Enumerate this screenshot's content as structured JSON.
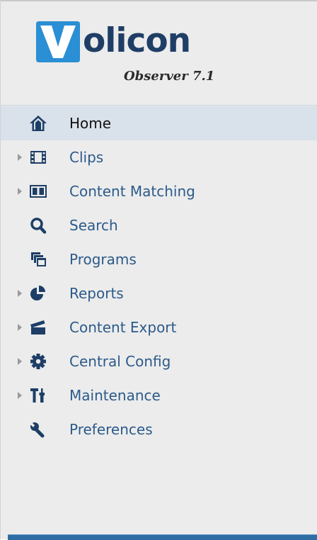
{
  "brand": {
    "logo_text": "olicon",
    "logo_initial": "V",
    "subtitle": "Observer 7.1",
    "logo_color": "#1f3e66",
    "accent_color": "#2a8fd4"
  },
  "nav": {
    "items": [
      {
        "label": "Home",
        "icon": "home-icon",
        "expandable": false,
        "active": true
      },
      {
        "label": "Clips",
        "icon": "film-icon",
        "expandable": true,
        "active": false
      },
      {
        "label": "Content Matching",
        "icon": "content-matching-icon",
        "expandable": true,
        "active": false
      },
      {
        "label": "Search",
        "icon": "search-icon",
        "expandable": false,
        "active": false
      },
      {
        "label": "Programs",
        "icon": "programs-icon",
        "expandable": false,
        "active": false
      },
      {
        "label": "Reports",
        "icon": "pie-chart-icon",
        "expandable": true,
        "active": false
      },
      {
        "label": "Content Export",
        "icon": "clapperboard-icon",
        "expandable": true,
        "active": false
      },
      {
        "label": "Central Config",
        "icon": "gear-icon",
        "expandable": true,
        "active": false
      },
      {
        "label": "Maintenance",
        "icon": "tools-icon",
        "expandable": true,
        "active": false
      },
      {
        "label": "Preferences",
        "icon": "wrench-icon",
        "expandable": false,
        "active": false
      }
    ]
  },
  "colors": {
    "label": "#2c5a8a",
    "active_label": "#111111",
    "active_background": "#d9e1ea",
    "icon": "#1d3e66",
    "sidebar_background": "#ececec"
  }
}
